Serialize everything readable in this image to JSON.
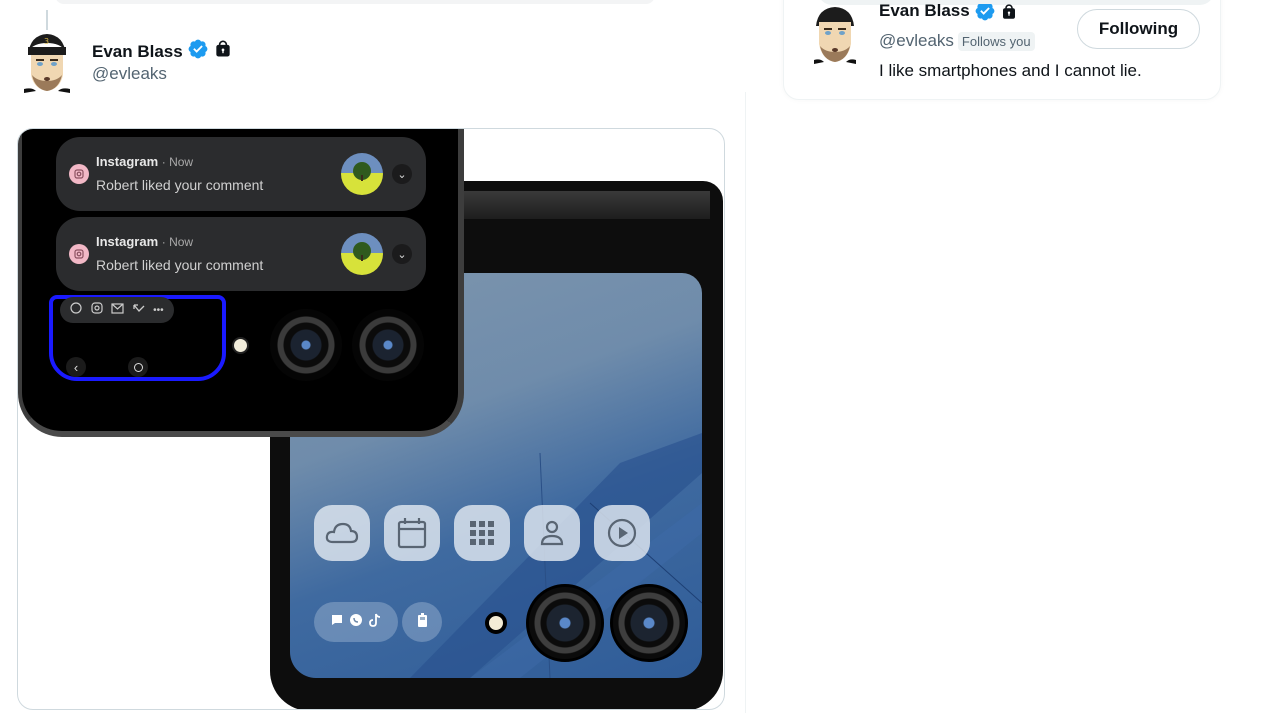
{
  "tweet": {
    "author": {
      "name": "Evan Blass",
      "handle": "@evleaks",
      "verified": true,
      "protected": true,
      "avatar_icon": "cartoon-avatar"
    },
    "media": {
      "description": "Two flip phone cover screens mockup",
      "top_phone": {
        "notifications": [
          {
            "app": "Instagram",
            "time": "· Now",
            "text": "Robert liked your comment"
          },
          {
            "app": "Instagram",
            "time": "· Now",
            "text": "Robert liked your comment"
          }
        ],
        "shortcut_icons": [
          "whatsapp-icon",
          "instagram-icon",
          "mail-icon",
          "missed-call-icon",
          "more-icon"
        ],
        "nav_icons": [
          "back-icon",
          "home-icon"
        ],
        "highlight_color": "#1a1aff"
      },
      "bottom_phone": {
        "app_icons": [
          "cloud-icon",
          "calendar-icon",
          "apps-grid-icon",
          "person-icon",
          "play-icon"
        ],
        "status_icons": [
          "message-icon",
          "whatsapp-icon",
          "tiktok-icon"
        ],
        "battery_icon": "battery-icon"
      }
    }
  },
  "hover_card": {
    "name": "Evan Blass",
    "handle": "@evleaks",
    "follows_you_label": "Follows you",
    "follow_button_label": "Following",
    "bio": "I like smartphones and I cannot lie.",
    "verified": true,
    "protected": true
  },
  "colors": {
    "verified_blue": "#1d9bf0",
    "text_primary": "#0f1419",
    "text_secondary": "#536471",
    "border": "#cfd9de"
  }
}
